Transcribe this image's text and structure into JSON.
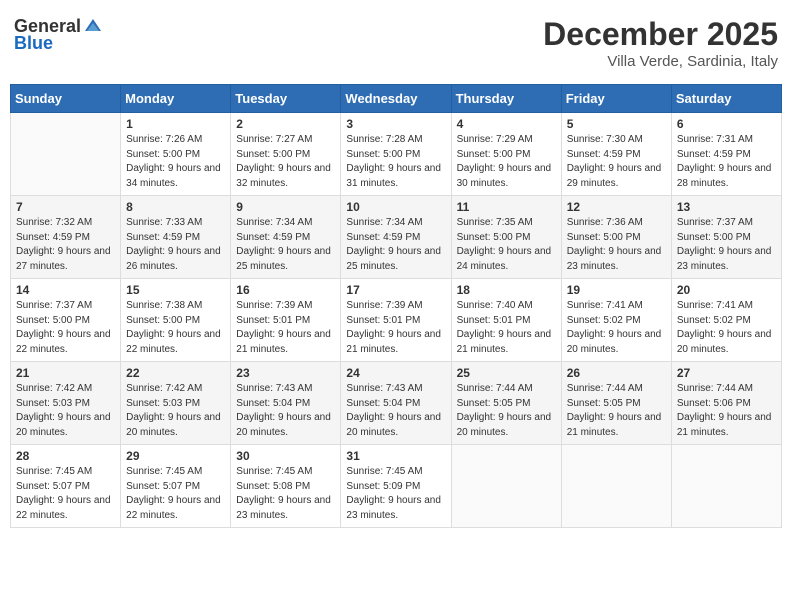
{
  "header": {
    "logo_general": "General",
    "logo_blue": "Blue",
    "month_title": "December 2025",
    "location": "Villa Verde, Sardinia, Italy"
  },
  "days_of_week": [
    "Sunday",
    "Monday",
    "Tuesday",
    "Wednesday",
    "Thursday",
    "Friday",
    "Saturday"
  ],
  "weeks": [
    [
      {
        "day": "",
        "sunrise": "",
        "sunset": "",
        "daylight": ""
      },
      {
        "day": "1",
        "sunrise": "Sunrise: 7:26 AM",
        "sunset": "Sunset: 5:00 PM",
        "daylight": "Daylight: 9 hours and 34 minutes."
      },
      {
        "day": "2",
        "sunrise": "Sunrise: 7:27 AM",
        "sunset": "Sunset: 5:00 PM",
        "daylight": "Daylight: 9 hours and 32 minutes."
      },
      {
        "day": "3",
        "sunrise": "Sunrise: 7:28 AM",
        "sunset": "Sunset: 5:00 PM",
        "daylight": "Daylight: 9 hours and 31 minutes."
      },
      {
        "day": "4",
        "sunrise": "Sunrise: 7:29 AM",
        "sunset": "Sunset: 5:00 PM",
        "daylight": "Daylight: 9 hours and 30 minutes."
      },
      {
        "day": "5",
        "sunrise": "Sunrise: 7:30 AM",
        "sunset": "Sunset: 4:59 PM",
        "daylight": "Daylight: 9 hours and 29 minutes."
      },
      {
        "day": "6",
        "sunrise": "Sunrise: 7:31 AM",
        "sunset": "Sunset: 4:59 PM",
        "daylight": "Daylight: 9 hours and 28 minutes."
      }
    ],
    [
      {
        "day": "7",
        "sunrise": "Sunrise: 7:32 AM",
        "sunset": "Sunset: 4:59 PM",
        "daylight": "Daylight: 9 hours and 27 minutes."
      },
      {
        "day": "8",
        "sunrise": "Sunrise: 7:33 AM",
        "sunset": "Sunset: 4:59 PM",
        "daylight": "Daylight: 9 hours and 26 minutes."
      },
      {
        "day": "9",
        "sunrise": "Sunrise: 7:34 AM",
        "sunset": "Sunset: 4:59 PM",
        "daylight": "Daylight: 9 hours and 25 minutes."
      },
      {
        "day": "10",
        "sunrise": "Sunrise: 7:34 AM",
        "sunset": "Sunset: 4:59 PM",
        "daylight": "Daylight: 9 hours and 25 minutes."
      },
      {
        "day": "11",
        "sunrise": "Sunrise: 7:35 AM",
        "sunset": "Sunset: 5:00 PM",
        "daylight": "Daylight: 9 hours and 24 minutes."
      },
      {
        "day": "12",
        "sunrise": "Sunrise: 7:36 AM",
        "sunset": "Sunset: 5:00 PM",
        "daylight": "Daylight: 9 hours and 23 minutes."
      },
      {
        "day": "13",
        "sunrise": "Sunrise: 7:37 AM",
        "sunset": "Sunset: 5:00 PM",
        "daylight": "Daylight: 9 hours and 23 minutes."
      }
    ],
    [
      {
        "day": "14",
        "sunrise": "Sunrise: 7:37 AM",
        "sunset": "Sunset: 5:00 PM",
        "daylight": "Daylight: 9 hours and 22 minutes."
      },
      {
        "day": "15",
        "sunrise": "Sunrise: 7:38 AM",
        "sunset": "Sunset: 5:00 PM",
        "daylight": "Daylight: 9 hours and 22 minutes."
      },
      {
        "day": "16",
        "sunrise": "Sunrise: 7:39 AM",
        "sunset": "Sunset: 5:01 PM",
        "daylight": "Daylight: 9 hours and 21 minutes."
      },
      {
        "day": "17",
        "sunrise": "Sunrise: 7:39 AM",
        "sunset": "Sunset: 5:01 PM",
        "daylight": "Daylight: 9 hours and 21 minutes."
      },
      {
        "day": "18",
        "sunrise": "Sunrise: 7:40 AM",
        "sunset": "Sunset: 5:01 PM",
        "daylight": "Daylight: 9 hours and 21 minutes."
      },
      {
        "day": "19",
        "sunrise": "Sunrise: 7:41 AM",
        "sunset": "Sunset: 5:02 PM",
        "daylight": "Daylight: 9 hours and 20 minutes."
      },
      {
        "day": "20",
        "sunrise": "Sunrise: 7:41 AM",
        "sunset": "Sunset: 5:02 PM",
        "daylight": "Daylight: 9 hours and 20 minutes."
      }
    ],
    [
      {
        "day": "21",
        "sunrise": "Sunrise: 7:42 AM",
        "sunset": "Sunset: 5:03 PM",
        "daylight": "Daylight: 9 hours and 20 minutes."
      },
      {
        "day": "22",
        "sunrise": "Sunrise: 7:42 AM",
        "sunset": "Sunset: 5:03 PM",
        "daylight": "Daylight: 9 hours and 20 minutes."
      },
      {
        "day": "23",
        "sunrise": "Sunrise: 7:43 AM",
        "sunset": "Sunset: 5:04 PM",
        "daylight": "Daylight: 9 hours and 20 minutes."
      },
      {
        "day": "24",
        "sunrise": "Sunrise: 7:43 AM",
        "sunset": "Sunset: 5:04 PM",
        "daylight": "Daylight: 9 hours and 20 minutes."
      },
      {
        "day": "25",
        "sunrise": "Sunrise: 7:44 AM",
        "sunset": "Sunset: 5:05 PM",
        "daylight": "Daylight: 9 hours and 20 minutes."
      },
      {
        "day": "26",
        "sunrise": "Sunrise: 7:44 AM",
        "sunset": "Sunset: 5:05 PM",
        "daylight": "Daylight: 9 hours and 21 minutes."
      },
      {
        "day": "27",
        "sunrise": "Sunrise: 7:44 AM",
        "sunset": "Sunset: 5:06 PM",
        "daylight": "Daylight: 9 hours and 21 minutes."
      }
    ],
    [
      {
        "day": "28",
        "sunrise": "Sunrise: 7:45 AM",
        "sunset": "Sunset: 5:07 PM",
        "daylight": "Daylight: 9 hours and 22 minutes."
      },
      {
        "day": "29",
        "sunrise": "Sunrise: 7:45 AM",
        "sunset": "Sunset: 5:07 PM",
        "daylight": "Daylight: 9 hours and 22 minutes."
      },
      {
        "day": "30",
        "sunrise": "Sunrise: 7:45 AM",
        "sunset": "Sunset: 5:08 PM",
        "daylight": "Daylight: 9 hours and 23 minutes."
      },
      {
        "day": "31",
        "sunrise": "Sunrise: 7:45 AM",
        "sunset": "Sunset: 5:09 PM",
        "daylight": "Daylight: 9 hours and 23 minutes."
      },
      {
        "day": "",
        "sunrise": "",
        "sunset": "",
        "daylight": ""
      },
      {
        "day": "",
        "sunrise": "",
        "sunset": "",
        "daylight": ""
      },
      {
        "day": "",
        "sunrise": "",
        "sunset": "",
        "daylight": ""
      }
    ]
  ]
}
